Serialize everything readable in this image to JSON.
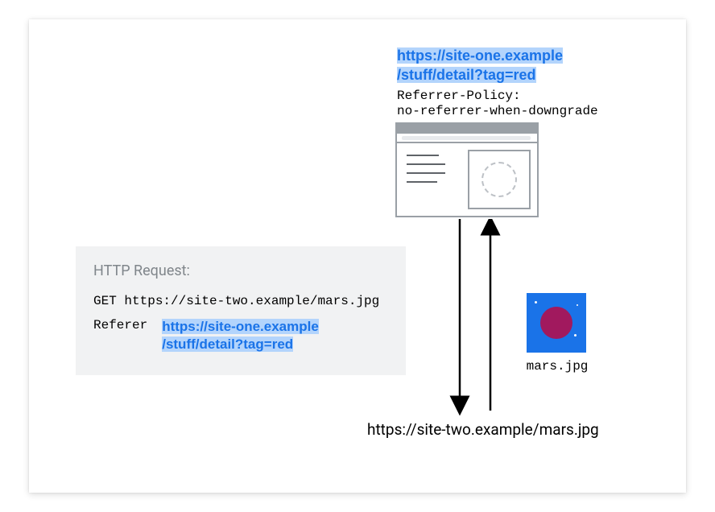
{
  "top_url_line1": "https://site-one.example",
  "top_url_line2": "/stuff/detail?tag=red",
  "policy_line1": "Referrer-Policy:",
  "policy_line2": "no-referrer-when-downgrade",
  "http": {
    "title": "HTTP Request:",
    "get_line": "GET https://site-two.example/mars.jpg",
    "referer_label": "Referer",
    "referer_line1": "https://site-one.example",
    "referer_line2": "/stuff/detail?tag=red"
  },
  "mars_label": "mars.jpg",
  "bottom_url": "https://site-two.example/mars.jpg"
}
